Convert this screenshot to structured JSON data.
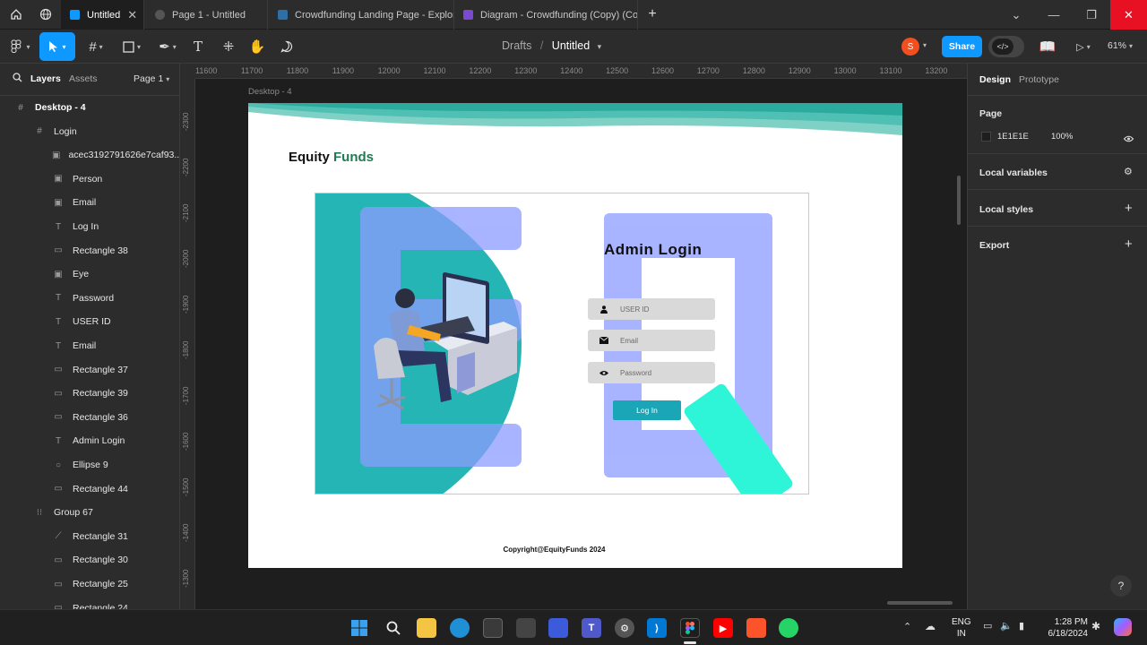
{
  "browser": {
    "tabs": [
      {
        "label": "Untitled",
        "active": true,
        "color": "#0d99ff"
      },
      {
        "label": "Page 1 - Untitled",
        "active": false,
        "color": "#555555"
      },
      {
        "label": "Crowdfunding Landing Page - Explor",
        "active": false,
        "color": "#2f6fa8"
      },
      {
        "label": "Diagram - Crowdfunding (Copy) (Cor",
        "active": false,
        "color": "#7a4bd0"
      }
    ],
    "new_tab": "+"
  },
  "toolbar": {
    "breadcrumb_parent": "Drafts",
    "breadcrumb_sep": "/",
    "file_name": "Untitled",
    "avatar_initial": "S",
    "share_label": "Share",
    "zoom": "61%"
  },
  "left_panel": {
    "tab_layers": "Layers",
    "tab_assets": "Assets",
    "page_selector": "Page 1",
    "layers": [
      {
        "label": "Desktop - 4",
        "icon": "#",
        "indent": 0,
        "bold": true
      },
      {
        "label": "Login",
        "icon": "#",
        "indent": 1
      },
      {
        "label": "acec3192791626e7caf93...",
        "icon": "▣",
        "indent": 2
      },
      {
        "label": "Person",
        "icon": "▣",
        "indent": 2
      },
      {
        "label": "Email",
        "icon": "▣",
        "indent": 2
      },
      {
        "label": "Log In",
        "icon": "T",
        "indent": 2
      },
      {
        "label": "Rectangle 38",
        "icon": "▭",
        "indent": 2
      },
      {
        "label": "Eye",
        "icon": "▣",
        "indent": 2
      },
      {
        "label": "Password",
        "icon": "T",
        "indent": 2
      },
      {
        "label": "USER ID",
        "icon": "T",
        "indent": 2
      },
      {
        "label": "Email",
        "icon": "T",
        "indent": 2
      },
      {
        "label": "Rectangle 37",
        "icon": "▭",
        "indent": 2
      },
      {
        "label": "Rectangle 39",
        "icon": "▭",
        "indent": 2
      },
      {
        "label": "Rectangle 36",
        "icon": "▭",
        "indent": 2
      },
      {
        "label": "Admin Login",
        "icon": "T",
        "indent": 2
      },
      {
        "label": "Ellipse 9",
        "icon": "○",
        "indent": 2
      },
      {
        "label": "Rectangle 44",
        "icon": "▭",
        "indent": 2
      },
      {
        "label": "Group 67",
        "icon": "⁝⁝",
        "indent": 1
      },
      {
        "label": "Rectangle 31",
        "icon": "⟋",
        "indent": 2
      },
      {
        "label": "Rectangle 30",
        "icon": "▭",
        "indent": 2
      },
      {
        "label": "Rectangle 25",
        "icon": "▭",
        "indent": 2
      },
      {
        "label": "Rectangle 24",
        "icon": "▭",
        "indent": 2
      }
    ]
  },
  "right_panel": {
    "tab_design": "Design",
    "tab_prototype": "Prototype",
    "page_heading": "Page",
    "page_color": "1E1E1E",
    "page_opacity": "100%",
    "local_variables": "Local variables",
    "local_styles": "Local styles",
    "export": "Export"
  },
  "canvas": {
    "frame_label": "Desktop - 4",
    "ruler_top": [
      "11600",
      "11700",
      "11800",
      "11900",
      "12000",
      "12100",
      "12200",
      "12300",
      "12400",
      "12500",
      "12600",
      "12700",
      "12800",
      "12900",
      "13000",
      "13100",
      "13200"
    ],
    "ruler_left": [
      "-2300",
      "-2200",
      "-2100",
      "-2000",
      "-1900",
      "-1800",
      "-1700",
      "-1600",
      "-1500",
      "-1400",
      "-1300"
    ]
  },
  "design": {
    "brand_first": "Equity",
    "brand_second": "Funds",
    "heading": "Admin Login",
    "user_id_placeholder": "USER ID",
    "email_placeholder": "Email",
    "password_placeholder": "Password",
    "login_button": "Log In",
    "copyright": "Copyright@EquityFunds 2024",
    "colors": {
      "teal": "#26b5b5",
      "brand_green": "#1f7a55",
      "blue_letter": "#8c9cff",
      "accent_cyan": "#2ff5d8",
      "button": "#1aa6b7"
    }
  },
  "taskbar": {
    "lang_top": "ENG",
    "lang_bottom": "IN",
    "time": "1:28 PM",
    "date": "6/18/2024"
  },
  "help": "?"
}
